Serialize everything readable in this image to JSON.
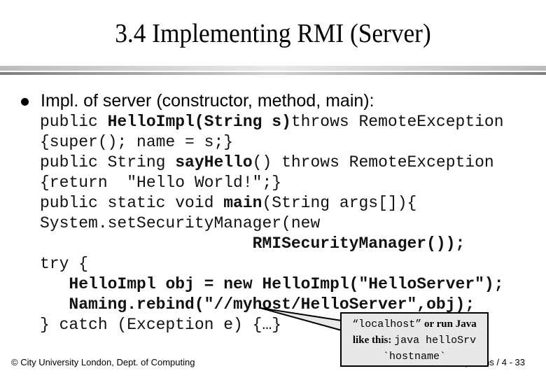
{
  "slide": {
    "title": "3.4 Implementing RMI (Server)",
    "bullet": "Impl. of server (constructor, method, main):",
    "code_lines": [
      {
        "parts": [
          {
            "t": "public ",
            "b": false
          },
          {
            "t": "HelloImpl(String s)",
            "b": true
          },
          {
            "t": "throws RemoteException",
            "b": false
          }
        ]
      },
      {
        "parts": [
          {
            "t": "{super(); name = s;}",
            "b": false
          }
        ]
      },
      {
        "parts": [
          {
            "t": "public String ",
            "b": false
          },
          {
            "t": "sayHello",
            "b": true
          },
          {
            "t": "() throws RemoteException",
            "b": false
          }
        ]
      },
      {
        "parts": [
          {
            "t": "{return  \"Hello World!\";}",
            "b": false
          }
        ]
      },
      {
        "parts": [
          {
            "t": "public static void ",
            "b": false
          },
          {
            "t": "main",
            "b": true
          },
          {
            "t": "(String args[]){",
            "b": false
          }
        ]
      },
      {
        "parts": [
          {
            "t": "System.setSecurityManager(new",
            "b": false
          }
        ]
      },
      {
        "parts": [
          {
            "t": "                      ",
            "b": false
          },
          {
            "t": "RMISecurityManager());",
            "b": true
          }
        ]
      },
      {
        "parts": [
          {
            "t": "try {",
            "b": false
          }
        ]
      },
      {
        "parts": [
          {
            "t": "   ",
            "b": false
          },
          {
            "t": "HelloImpl obj = new HelloImpl(\"HelloServer\");",
            "b": true
          }
        ]
      },
      {
        "parts": [
          {
            "t": "   ",
            "b": false
          },
          {
            "t": "Naming.rebind(\"//myhost/HelloServer\",obj);",
            "b": true
          }
        ]
      },
      {
        "parts": [
          {
            "t": "} catch (Exception e) {…}",
            "b": false
          }
        ]
      }
    ],
    "callout": {
      "line1_mono": "“localhost”",
      "line1_bold": " or run Java",
      "line2_bold": "like this: ",
      "line2_mono": "java helloSrv",
      "line3_mono": "`hostname`"
    },
    "footer_left": "© City University London, Dept. of Computing",
    "footer_right": "Distributed Systems / 4 - 33"
  }
}
